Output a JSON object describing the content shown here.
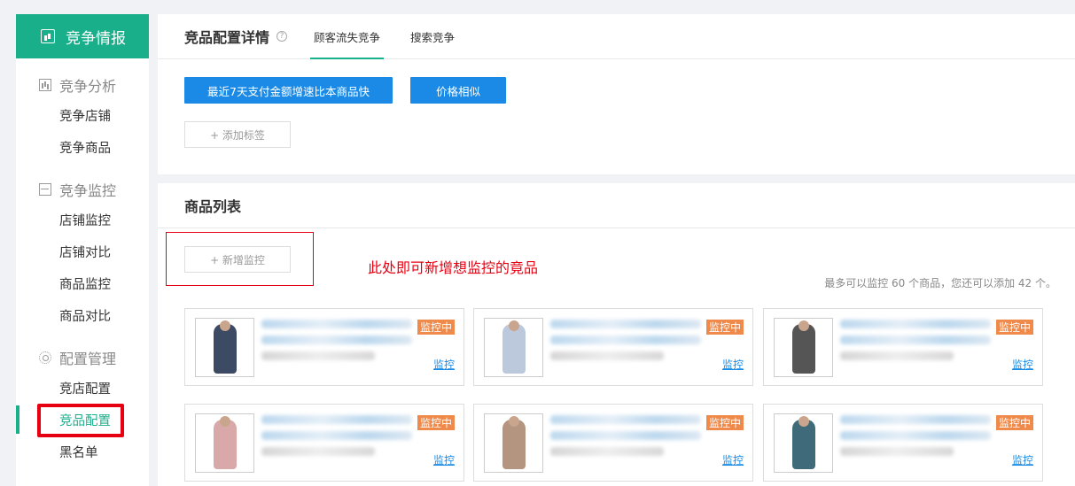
{
  "sidebar": {
    "header": "竞争情报",
    "groups": [
      {
        "title": "竞争分析",
        "items": [
          "竞争店铺",
          "竞争商品"
        ]
      },
      {
        "title": "竞争监控",
        "items": [
          "店铺监控",
          "店铺对比",
          "商品监控",
          "商品对比"
        ]
      },
      {
        "title": "配置管理",
        "items": [
          "竞店配置",
          "竞品配置",
          "黑名单"
        ]
      }
    ],
    "active_item": "竞品配置"
  },
  "config": {
    "title": "竞品配置详情",
    "tabs": [
      "顾客流失竞争",
      "搜索竞争"
    ],
    "active_tab": "顾客流失竞争",
    "tag_buttons": [
      "最近7天支付金额增速比本商品快",
      "价格相似"
    ],
    "add_tag_label": "+ 添加标签"
  },
  "product_list": {
    "title": "商品列表",
    "add_monitor_label": "+ 新增监控",
    "annotation": "此处即可新增想监控的竟品",
    "limit_text": "最多可以监控 60 个商品，您还可以添加 42 个。",
    "cards": [
      {
        "status": "监控中",
        "action": "监控",
        "thumb_color": "#3d4a63"
      },
      {
        "status": "监控中",
        "action": "监控",
        "thumb_color": "#bcc9dc"
      },
      {
        "status": "监控中",
        "action": "监控",
        "thumb_color": "#555555"
      },
      {
        "status": "监控中",
        "action": "监控",
        "thumb_color": "#d9a9a9"
      },
      {
        "status": "监控中",
        "action": "监控",
        "thumb_color": "#b49580"
      },
      {
        "status": "监控中",
        "action": "监控",
        "thumb_color": "#3f6a7a"
      }
    ]
  }
}
